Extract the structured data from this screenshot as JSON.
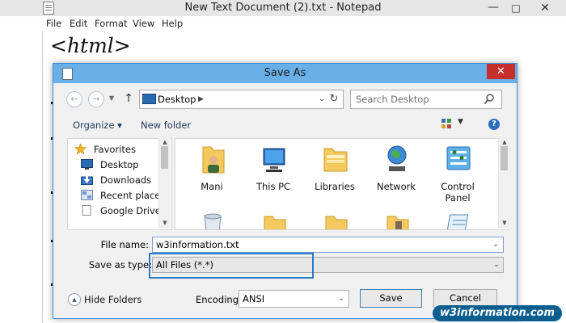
{
  "notepad": {
    "title": "New Text Document (2).txt - Notepad",
    "menu": [
      "File",
      "Edit",
      "Format",
      "View",
      "Help"
    ],
    "content": "<html>"
  },
  "dialog": {
    "title": "Save As",
    "address": {
      "location": "Desktop"
    },
    "search": {
      "placeholder": "Search Desktop"
    },
    "toolbar": {
      "organize_label": "Organize ▾",
      "new_folder_label": "New folder"
    },
    "nav_pane": {
      "items": [
        {
          "label": "Favorites",
          "icon": "star-icon"
        },
        {
          "label": "Desktop",
          "icon": "desktop-icon"
        },
        {
          "label": "Downloads",
          "icon": "downloads-icon"
        },
        {
          "label": "Recent places",
          "icon": "recent-places-icon"
        },
        {
          "label": "Google Drive",
          "icon": "google-drive-icon"
        }
      ]
    },
    "files": [
      {
        "label": "Mani",
        "icon": "user-folder-icon"
      },
      {
        "label": "This PC",
        "icon": "computer-icon"
      },
      {
        "label": "Libraries",
        "icon": "libraries-icon"
      },
      {
        "label": "Network",
        "icon": "network-icon"
      },
      {
        "label": "Control Panel",
        "icon": "control-panel-icon"
      }
    ],
    "fields": {
      "file_name_label": "File name:",
      "file_name_value": "w3information.txt",
      "save_type_label": "Save as type:",
      "save_type_value": "All Files  (*.*)"
    },
    "footer": {
      "hide_folders_label": "Hide Folders",
      "encoding_label": "Encoding:",
      "encoding_value": "ANSI",
      "save_label": "Save",
      "cancel_label": "Cancel"
    },
    "colors": {
      "title_bar": "#6ab0e8",
      "close_button": "#c7302a",
      "highlight": "#2979cc"
    }
  },
  "watermark": {
    "text": "w3information.com"
  }
}
